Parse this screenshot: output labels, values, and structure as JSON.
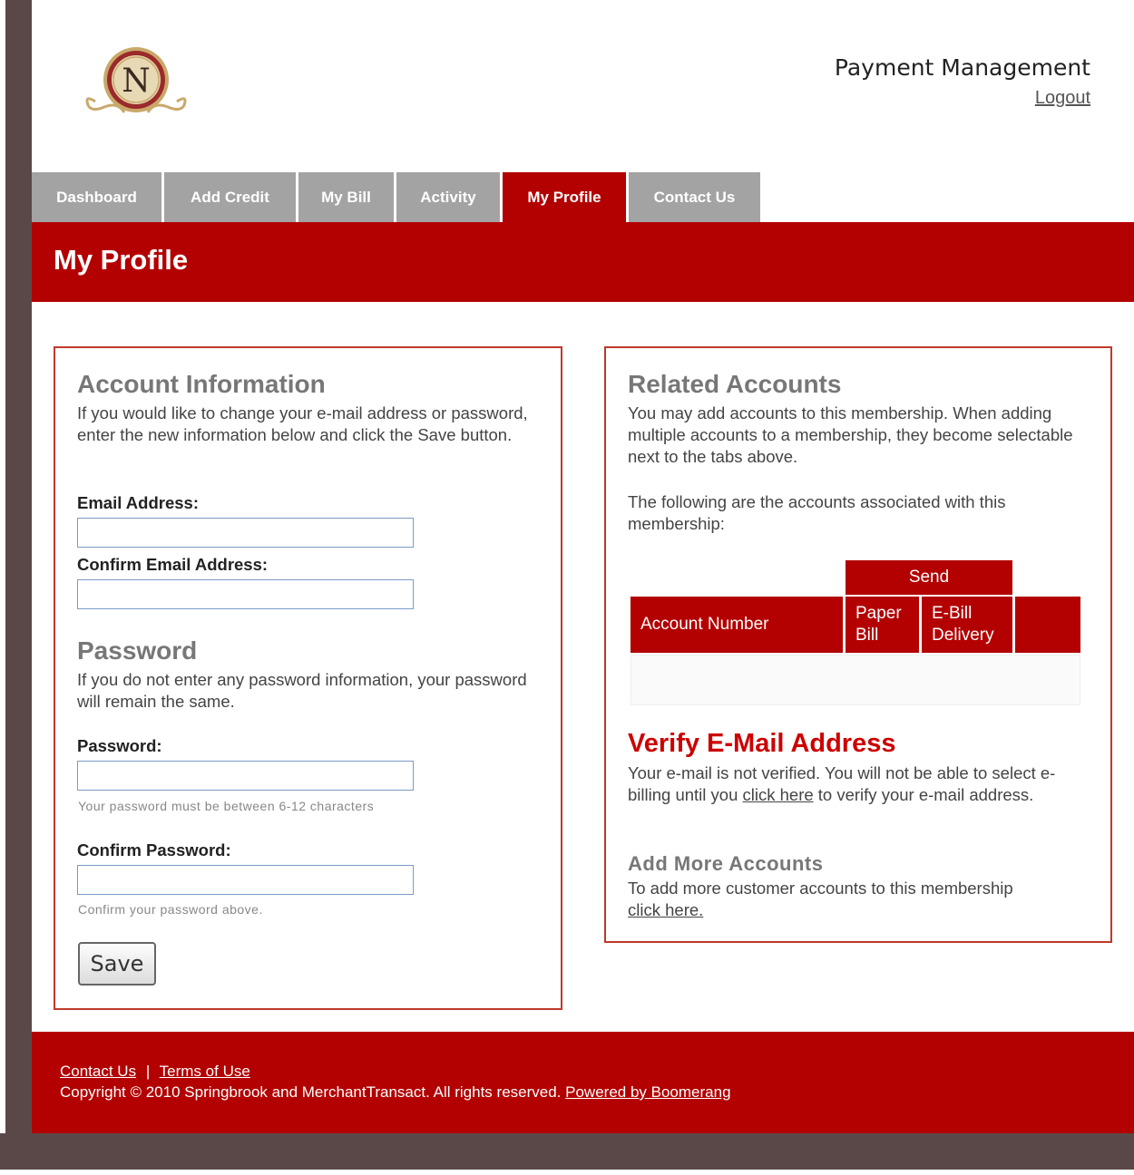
{
  "header": {
    "logo_letter": "N",
    "title": "Payment Management",
    "logout": "Logout"
  },
  "tabs": [
    {
      "label": "Dashboard",
      "active": false
    },
    {
      "label": "Add Credit",
      "active": false
    },
    {
      "label": "My Bill",
      "active": false
    },
    {
      "label": "Activity",
      "active": false
    },
    {
      "label": "My Profile",
      "active": true
    },
    {
      "label": "Contact Us",
      "active": false
    }
  ],
  "page_title": "My Profile",
  "account_info": {
    "heading": "Account Information",
    "intro": "If you would like to change your e-mail address or password, enter the new information below and click the Save button.",
    "email_label": "Email Address:",
    "email_value": "",
    "confirm_email_label": "Confirm Email Address:",
    "confirm_email_value": ""
  },
  "password_section": {
    "heading": "Password",
    "intro": "If you do not enter any password information, your password will remain the same.",
    "password_label": "Password:",
    "password_hint": "Your password must be between 6-12 characters",
    "confirm_label": "Confirm Password:",
    "confirm_hint": "Confirm your password above.",
    "save_label": "Save"
  },
  "related": {
    "heading": "Related Accounts",
    "intro": "You may add accounts to this membership. When adding multiple accounts to a membership, they become selectable next to the tabs above.",
    "following": "The following are the accounts associated with this membership:",
    "table": {
      "send_header": "Send",
      "columns": [
        "Account Number",
        "Paper Bill",
        "E-Bill Delivery",
        ""
      ],
      "rows": []
    }
  },
  "verify": {
    "heading": "Verify E-Mail Address",
    "text_before": "Your e-mail is not verified. You will not be able to select e-billing until you ",
    "link": "click here",
    "text_after": " to verify your e-mail address."
  },
  "add_more": {
    "heading": "Add More Accounts",
    "text": "To add more customer accounts to this membership",
    "link": "click here."
  },
  "footer": {
    "contact": "Contact Us",
    "separator": "|",
    "terms": "Terms of Use",
    "copyright": "Copyright © 2010 Springbrook and MerchantTransact. All rights reserved.",
    "powered": "Powered by Boomerang"
  },
  "colors": {
    "brand_red": "#b30000",
    "tab_gray": "#a3a3a3",
    "frame_brown": "#5a4848"
  }
}
